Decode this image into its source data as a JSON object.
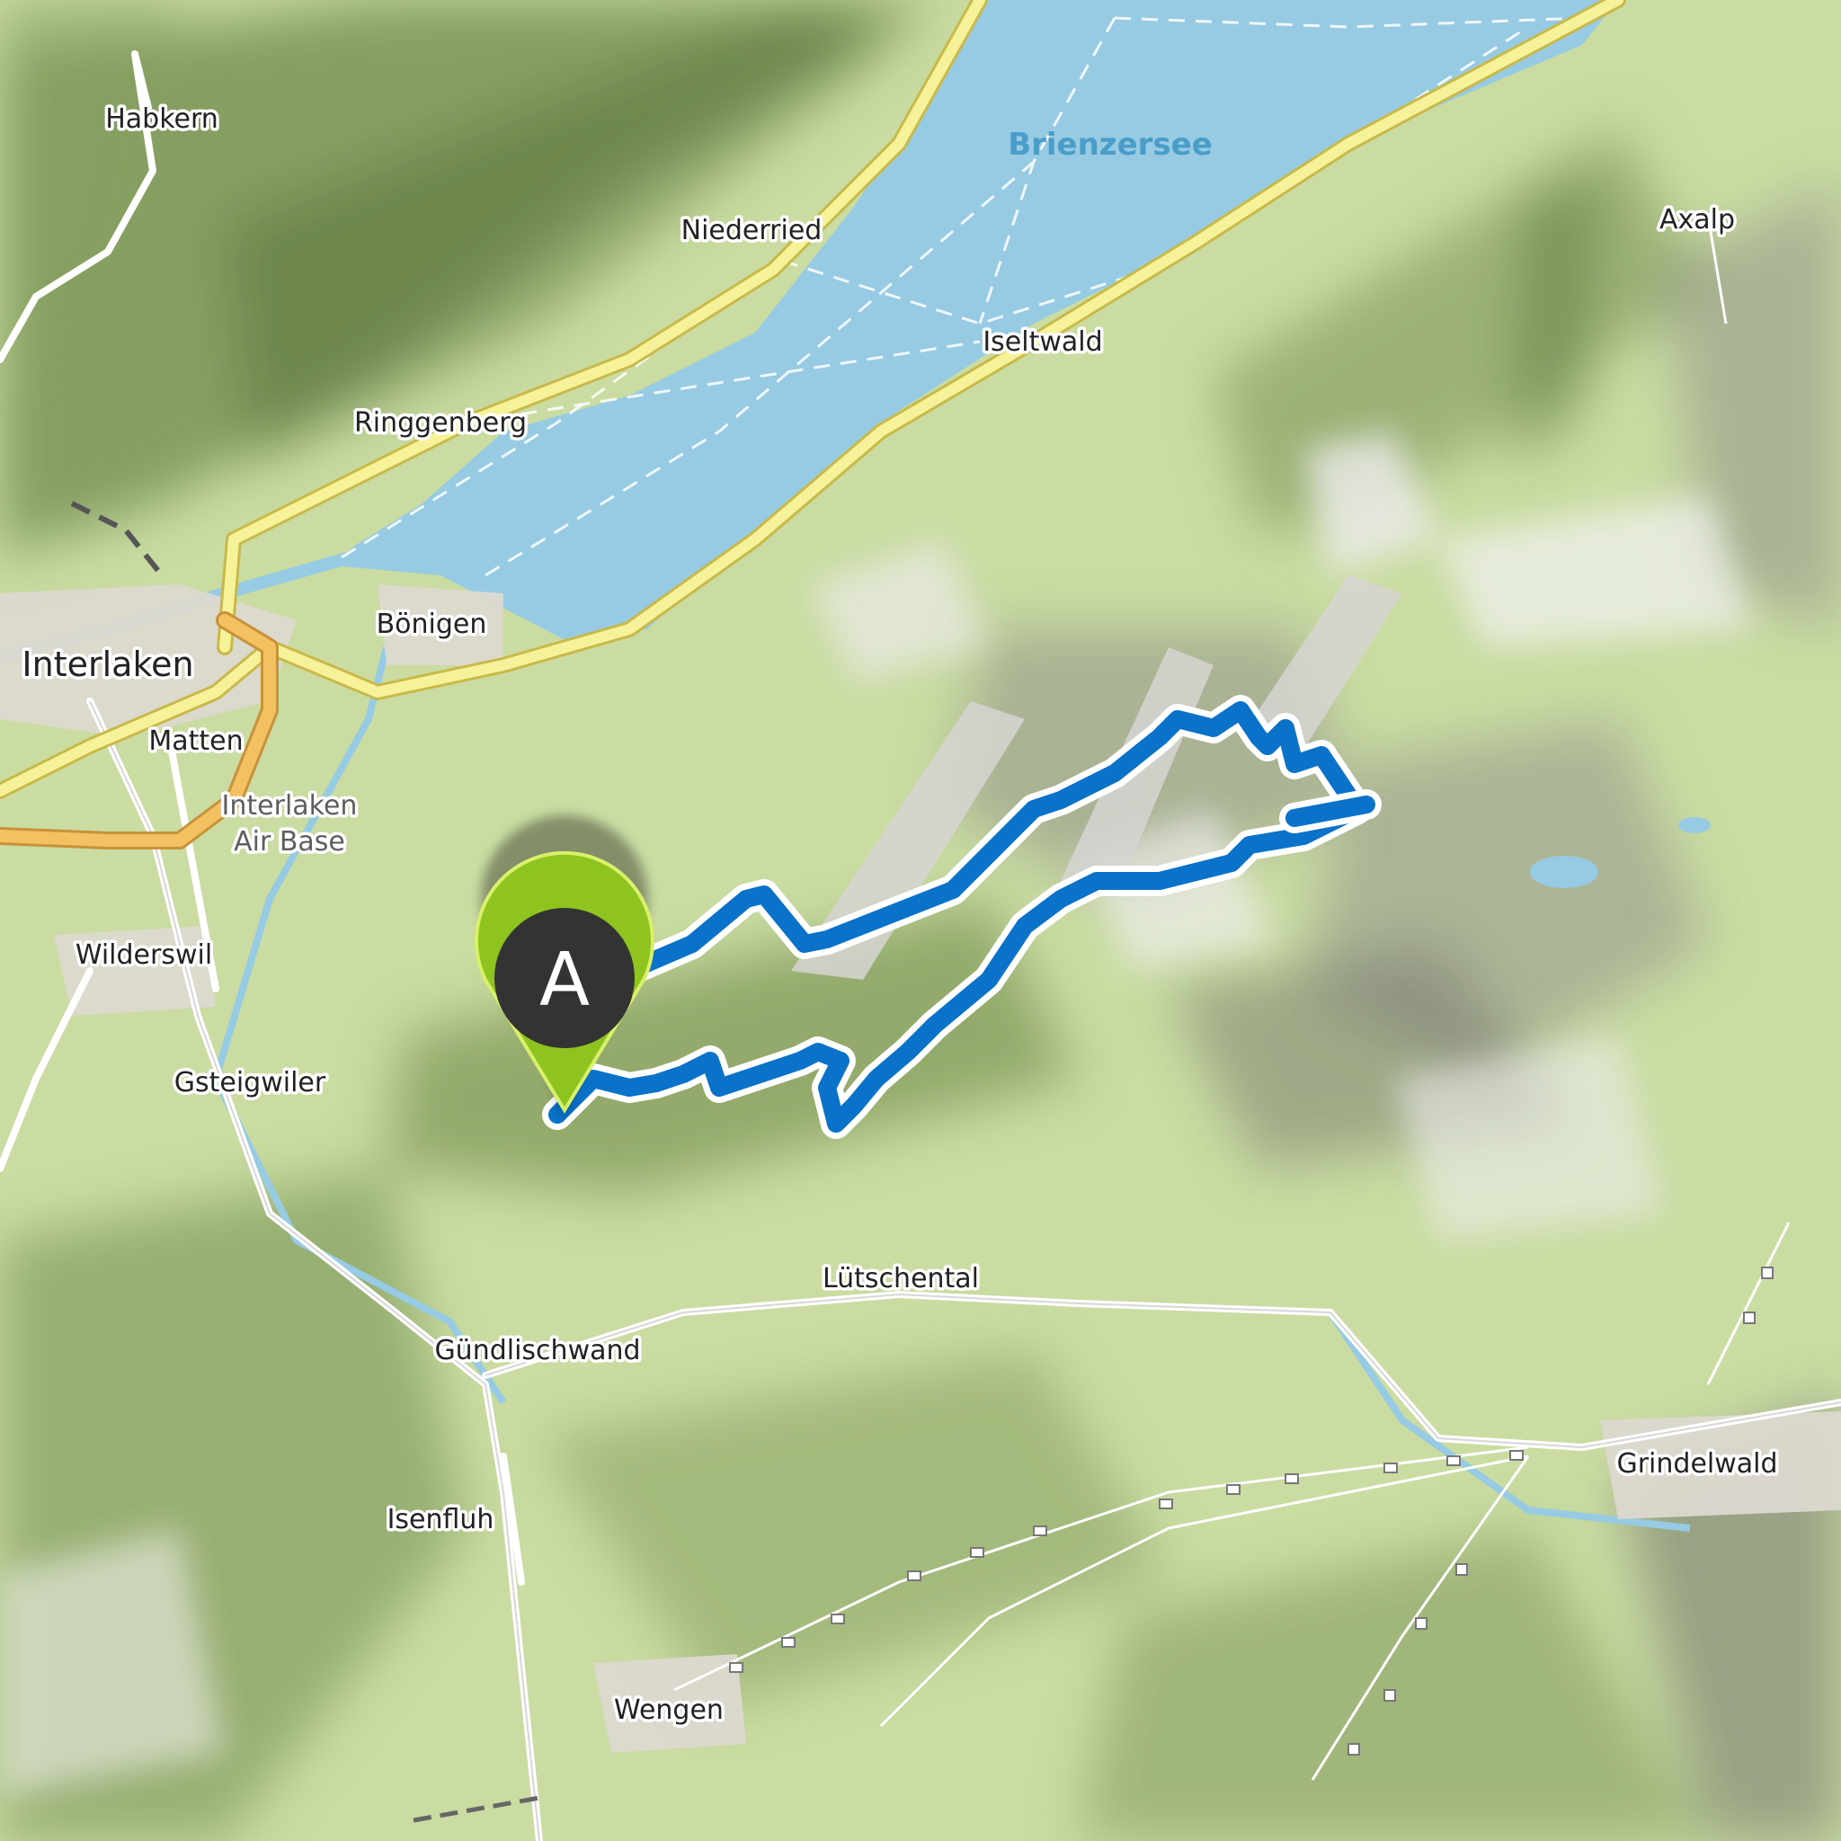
{
  "map": {
    "lake_name": "Brienzersee",
    "places": [
      {
        "id": "habkern",
        "name": "Habkern"
      },
      {
        "id": "niederried",
        "name": "Niederried"
      },
      {
        "id": "axalp",
        "name": "Axalp"
      },
      {
        "id": "iseltwald",
        "name": "Iseltwald"
      },
      {
        "id": "ringgenberg",
        "name": "Ringgenberg"
      },
      {
        "id": "boenigen",
        "name": "Bönigen"
      },
      {
        "id": "interlaken",
        "name": "Interlaken"
      },
      {
        "id": "matten",
        "name": "Matten"
      },
      {
        "id": "interlaken-air-base-1",
        "name": "Interlaken"
      },
      {
        "id": "interlaken-air-base-2",
        "name": "Air Base"
      },
      {
        "id": "wilderswil",
        "name": "Wilderswil"
      },
      {
        "id": "gsteigwiler",
        "name": "Gsteigwiler"
      },
      {
        "id": "luetschental",
        "name": "Lütschental"
      },
      {
        "id": "guendlischwand",
        "name": "Gündlischwand"
      },
      {
        "id": "grindelwald",
        "name": "Grindelwald"
      },
      {
        "id": "isenfluh",
        "name": "Isenfluh"
      },
      {
        "id": "wengen",
        "name": "Wengen"
      }
    ],
    "start_marker": {
      "letter": "A"
    },
    "colors": {
      "route": "#0a72c8",
      "marker_ring": "#8fc31f",
      "marker_fill": "#333333",
      "lake": "#96cbe3",
      "main_road": "#f6f29a",
      "motorway": "#f3c062"
    }
  }
}
